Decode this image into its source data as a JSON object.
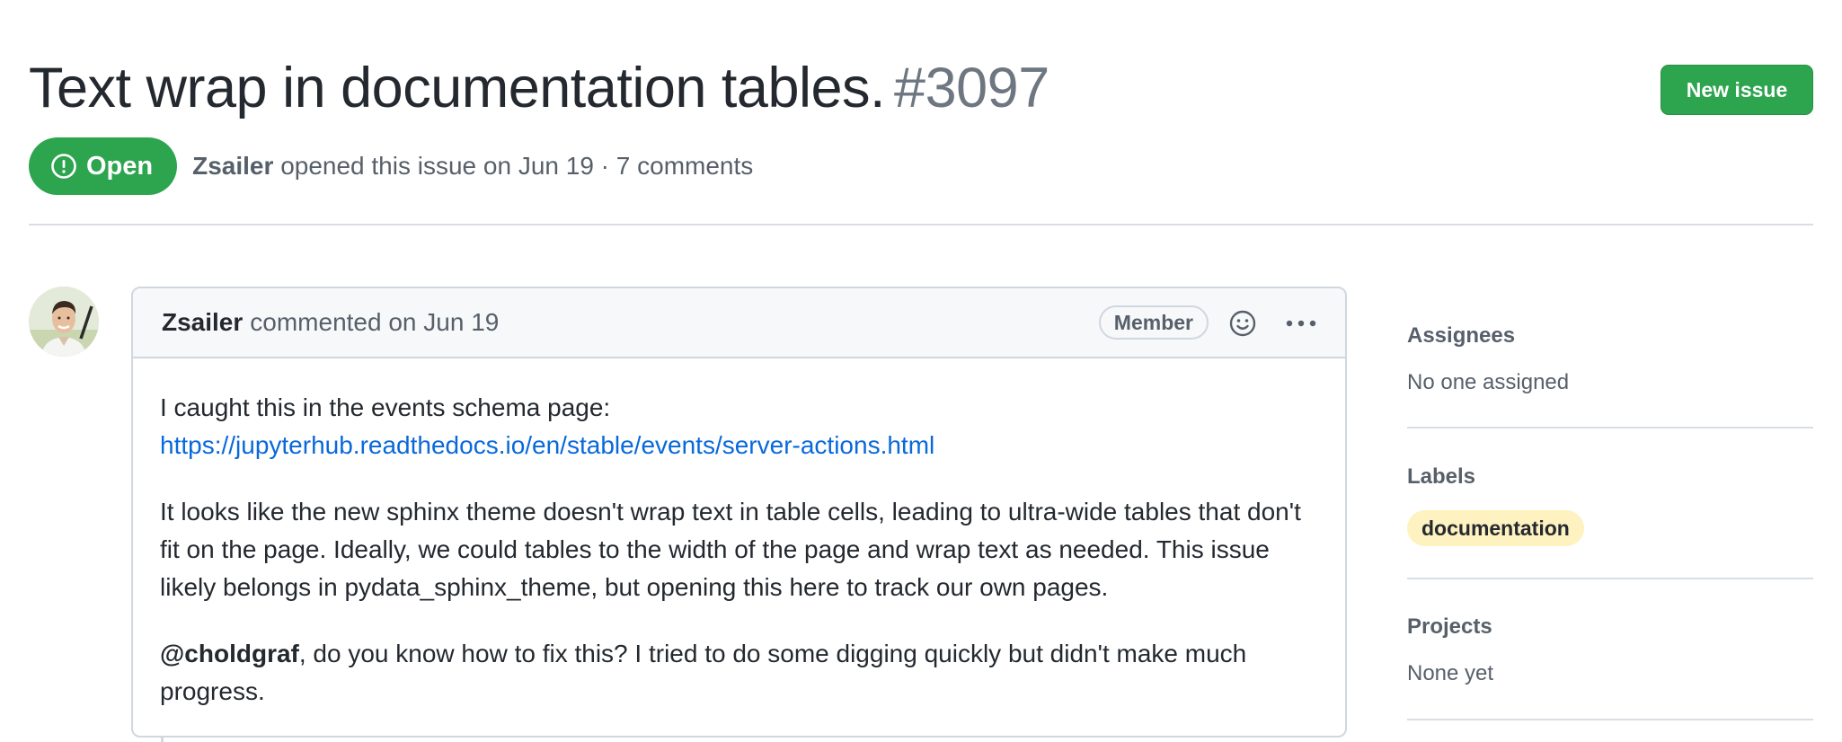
{
  "issue": {
    "title": "Text wrap in documentation tables.",
    "number": "#3097",
    "state": "Open",
    "author": "Zsailer",
    "meta_suffix": "opened this issue on Jun 19 · 7 comments"
  },
  "header": {
    "new_issue_label": "New issue",
    "new_issue_color": "#2da44e"
  },
  "comment": {
    "author": "Zsailer",
    "date_text": "commented on Jun 19",
    "role_badge": "Member",
    "reaction_icon": "smiley-icon",
    "menu_icon": "kebab-horizontal-icon",
    "body": {
      "para1_text": "I caught this in the events schema page:",
      "para1_link": "https://jupyterhub.readthedocs.io/en/stable/events/server-actions.html",
      "para2": "It looks like the new sphinx theme doesn't wrap text in table cells, leading to ultra-wide tables that don't fit on the page. Ideally, we could tables to the width of the page and wrap text as needed. This issue likely belongs in pydata_sphinx_theme, but opening this here to track our own pages.",
      "para3_mention": "@choldgraf",
      "para3_text": ", do you know how to fix this? I tried to do some digging quickly but didn't make much progress."
    }
  },
  "sidebar": {
    "assignees": {
      "heading": "Assignees",
      "value": "No one assigned"
    },
    "labels": {
      "heading": "Labels",
      "items": [
        "documentation"
      ],
      "label_color": "#fef2c0"
    },
    "projects": {
      "heading": "Projects",
      "value": "None yet"
    }
  },
  "colors": {
    "accent_green": "#2da44e",
    "link_blue": "#0969da",
    "muted_text": "#57606a",
    "border": "#d0d7de"
  }
}
